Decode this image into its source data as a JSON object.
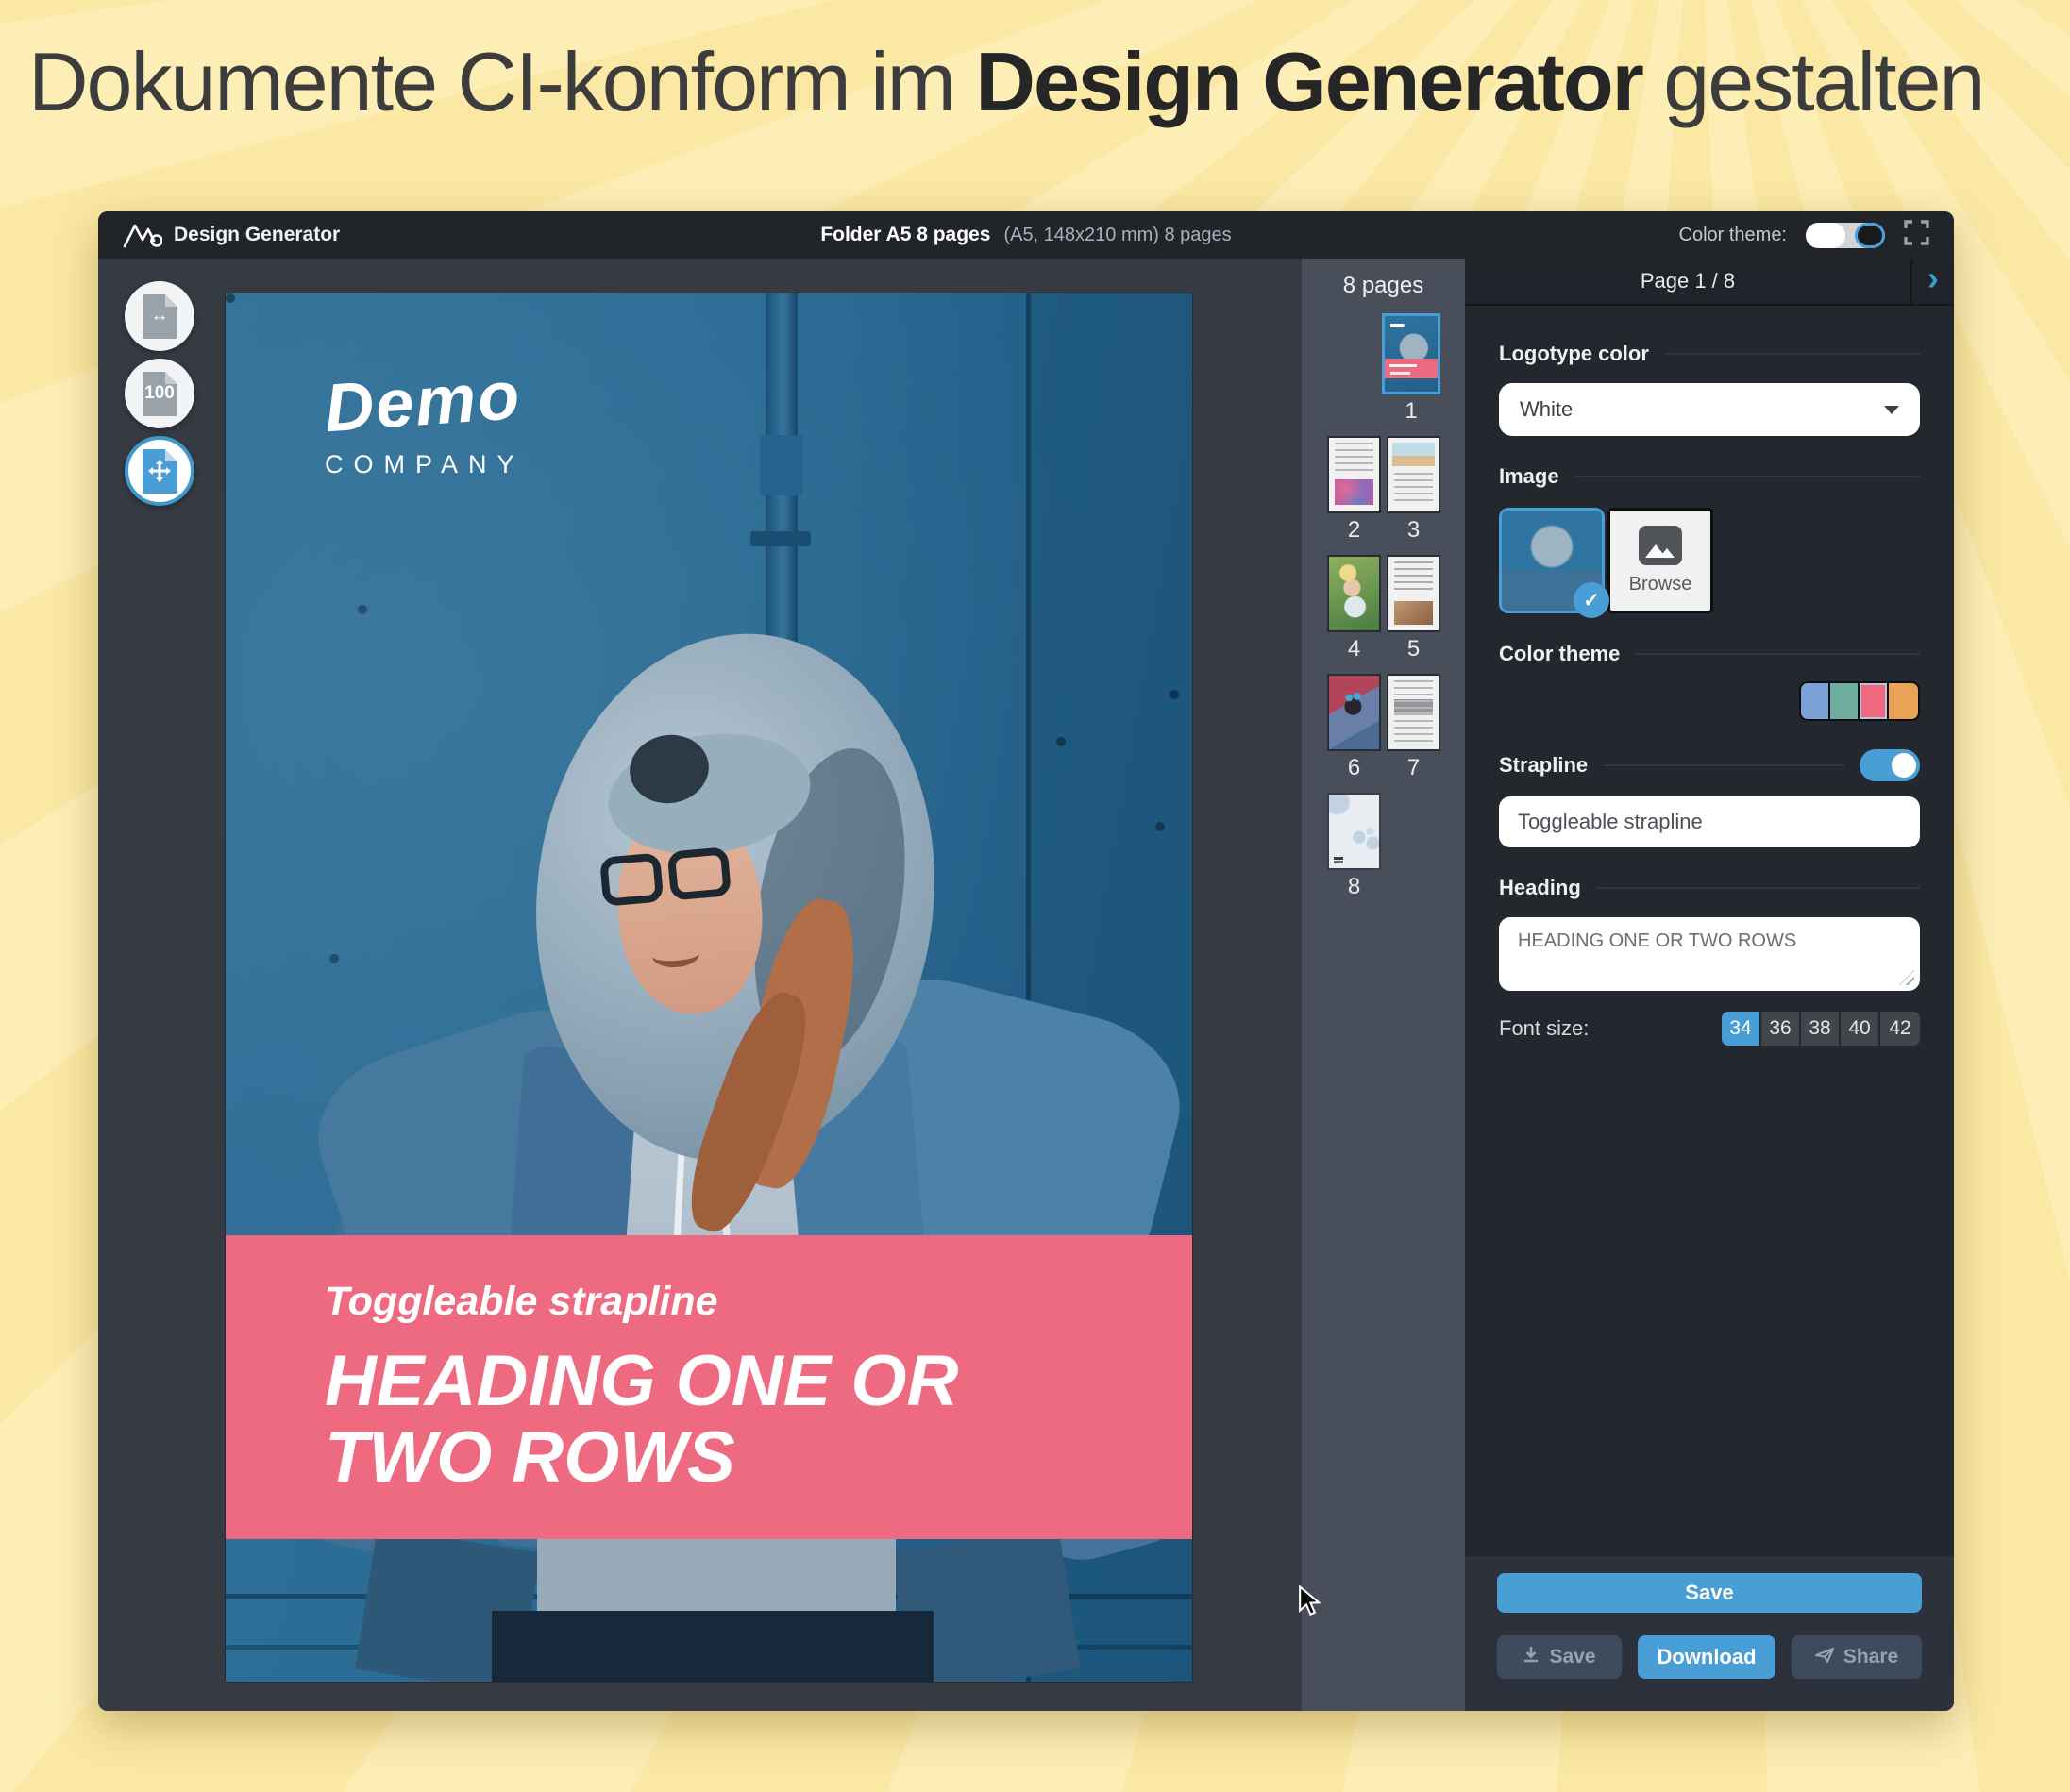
{
  "page": {
    "title_light": "Dokumente CI-konform im ",
    "title_bold": "Design Generator",
    "title_tail": " gestalten"
  },
  "topbar": {
    "app_name": "Design Generator",
    "doc_title": "Folder A5 8 pages",
    "doc_meta": "(A5, 148x210 mm) 8 pages",
    "color_theme_label": "Color theme:"
  },
  "tools": {
    "zoom_100_label": "100"
  },
  "canvas": {
    "logo_line1": "Demo",
    "logo_line2": "COMPANY",
    "strapline": "Toggleable strapline",
    "heading": "HEADING ONE OR TWO ROWS"
  },
  "pages_panel": {
    "header": "8 pages",
    "pages": [
      {
        "num": "1"
      },
      {
        "num": "2"
      },
      {
        "num": "3"
      },
      {
        "num": "4"
      },
      {
        "num": "5"
      },
      {
        "num": "6"
      },
      {
        "num": "7"
      },
      {
        "num": "8"
      }
    ]
  },
  "inspector": {
    "header": "Page 1 / 8",
    "logotype_color": {
      "label": "Logotype color",
      "value": "White"
    },
    "image": {
      "label": "Image",
      "browse_label": "Browse"
    },
    "color_theme": {
      "label": "Color theme",
      "swatches": [
        "#7ba1d6",
        "#6fae9e",
        "#ee6880",
        "#e8a356"
      ],
      "selected_index": 2
    },
    "strapline": {
      "label": "Strapline",
      "value": "Toggleable strapline",
      "enabled": true
    },
    "heading": {
      "label": "Heading",
      "value": "HEADING ONE OR TWO ROWS"
    },
    "font_size": {
      "label": "Font size:",
      "options": [
        "34",
        "36",
        "38",
        "40",
        "42"
      ],
      "selected": "34"
    },
    "actions": {
      "save_primary": "Save",
      "save_secondary": "Save",
      "download": "Download",
      "share": "Share"
    }
  },
  "colors": {
    "accent_blue": "#4a9ed6",
    "banner_pink": "#ed6a80",
    "background_yellow": "#fae8a4"
  }
}
